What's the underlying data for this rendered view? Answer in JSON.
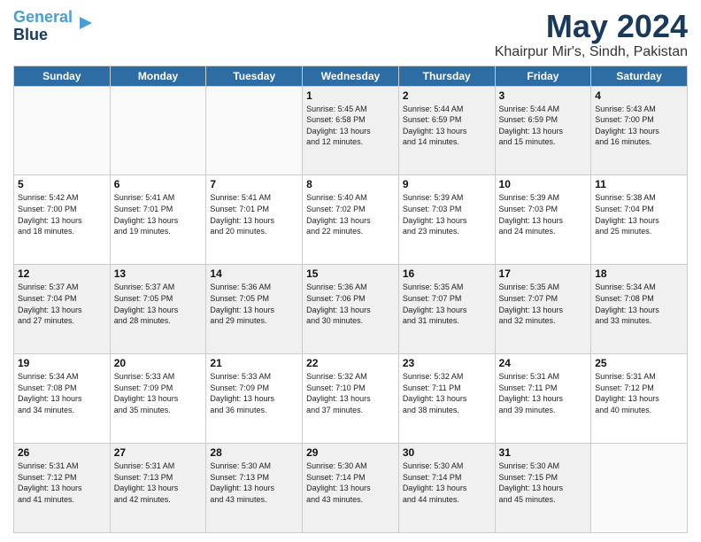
{
  "header": {
    "logo_line1": "General",
    "logo_line2": "Blue",
    "month": "May 2024",
    "location": "Khairpur Mir's, Sindh, Pakistan"
  },
  "days_of_week": [
    "Sunday",
    "Monday",
    "Tuesday",
    "Wednesday",
    "Thursday",
    "Friday",
    "Saturday"
  ],
  "weeks": [
    [
      {
        "day": "",
        "info": ""
      },
      {
        "day": "",
        "info": ""
      },
      {
        "day": "",
        "info": ""
      },
      {
        "day": "1",
        "info": "Sunrise: 5:45 AM\nSunset: 6:58 PM\nDaylight: 13 hours\nand 12 minutes."
      },
      {
        "day": "2",
        "info": "Sunrise: 5:44 AM\nSunset: 6:59 PM\nDaylight: 13 hours\nand 14 minutes."
      },
      {
        "day": "3",
        "info": "Sunrise: 5:44 AM\nSunset: 6:59 PM\nDaylight: 13 hours\nand 15 minutes."
      },
      {
        "day": "4",
        "info": "Sunrise: 5:43 AM\nSunset: 7:00 PM\nDaylight: 13 hours\nand 16 minutes."
      }
    ],
    [
      {
        "day": "5",
        "info": "Sunrise: 5:42 AM\nSunset: 7:00 PM\nDaylight: 13 hours\nand 18 minutes."
      },
      {
        "day": "6",
        "info": "Sunrise: 5:41 AM\nSunset: 7:01 PM\nDaylight: 13 hours\nand 19 minutes."
      },
      {
        "day": "7",
        "info": "Sunrise: 5:41 AM\nSunset: 7:01 PM\nDaylight: 13 hours\nand 20 minutes."
      },
      {
        "day": "8",
        "info": "Sunrise: 5:40 AM\nSunset: 7:02 PM\nDaylight: 13 hours\nand 22 minutes."
      },
      {
        "day": "9",
        "info": "Sunrise: 5:39 AM\nSunset: 7:03 PM\nDaylight: 13 hours\nand 23 minutes."
      },
      {
        "day": "10",
        "info": "Sunrise: 5:39 AM\nSunset: 7:03 PM\nDaylight: 13 hours\nand 24 minutes."
      },
      {
        "day": "11",
        "info": "Sunrise: 5:38 AM\nSunset: 7:04 PM\nDaylight: 13 hours\nand 25 minutes."
      }
    ],
    [
      {
        "day": "12",
        "info": "Sunrise: 5:37 AM\nSunset: 7:04 PM\nDaylight: 13 hours\nand 27 minutes."
      },
      {
        "day": "13",
        "info": "Sunrise: 5:37 AM\nSunset: 7:05 PM\nDaylight: 13 hours\nand 28 minutes."
      },
      {
        "day": "14",
        "info": "Sunrise: 5:36 AM\nSunset: 7:05 PM\nDaylight: 13 hours\nand 29 minutes."
      },
      {
        "day": "15",
        "info": "Sunrise: 5:36 AM\nSunset: 7:06 PM\nDaylight: 13 hours\nand 30 minutes."
      },
      {
        "day": "16",
        "info": "Sunrise: 5:35 AM\nSunset: 7:07 PM\nDaylight: 13 hours\nand 31 minutes."
      },
      {
        "day": "17",
        "info": "Sunrise: 5:35 AM\nSunset: 7:07 PM\nDaylight: 13 hours\nand 32 minutes."
      },
      {
        "day": "18",
        "info": "Sunrise: 5:34 AM\nSunset: 7:08 PM\nDaylight: 13 hours\nand 33 minutes."
      }
    ],
    [
      {
        "day": "19",
        "info": "Sunrise: 5:34 AM\nSunset: 7:08 PM\nDaylight: 13 hours\nand 34 minutes."
      },
      {
        "day": "20",
        "info": "Sunrise: 5:33 AM\nSunset: 7:09 PM\nDaylight: 13 hours\nand 35 minutes."
      },
      {
        "day": "21",
        "info": "Sunrise: 5:33 AM\nSunset: 7:09 PM\nDaylight: 13 hours\nand 36 minutes."
      },
      {
        "day": "22",
        "info": "Sunrise: 5:32 AM\nSunset: 7:10 PM\nDaylight: 13 hours\nand 37 minutes."
      },
      {
        "day": "23",
        "info": "Sunrise: 5:32 AM\nSunset: 7:11 PM\nDaylight: 13 hours\nand 38 minutes."
      },
      {
        "day": "24",
        "info": "Sunrise: 5:31 AM\nSunset: 7:11 PM\nDaylight: 13 hours\nand 39 minutes."
      },
      {
        "day": "25",
        "info": "Sunrise: 5:31 AM\nSunset: 7:12 PM\nDaylight: 13 hours\nand 40 minutes."
      }
    ],
    [
      {
        "day": "26",
        "info": "Sunrise: 5:31 AM\nSunset: 7:12 PM\nDaylight: 13 hours\nand 41 minutes."
      },
      {
        "day": "27",
        "info": "Sunrise: 5:31 AM\nSunset: 7:13 PM\nDaylight: 13 hours\nand 42 minutes."
      },
      {
        "day": "28",
        "info": "Sunrise: 5:30 AM\nSunset: 7:13 PM\nDaylight: 13 hours\nand 43 minutes."
      },
      {
        "day": "29",
        "info": "Sunrise: 5:30 AM\nSunset: 7:14 PM\nDaylight: 13 hours\nand 43 minutes."
      },
      {
        "day": "30",
        "info": "Sunrise: 5:30 AM\nSunset: 7:14 PM\nDaylight: 13 hours\nand 44 minutes."
      },
      {
        "day": "31",
        "info": "Sunrise: 5:30 AM\nSunset: 7:15 PM\nDaylight: 13 hours\nand 45 minutes."
      },
      {
        "day": "",
        "info": ""
      }
    ]
  ]
}
